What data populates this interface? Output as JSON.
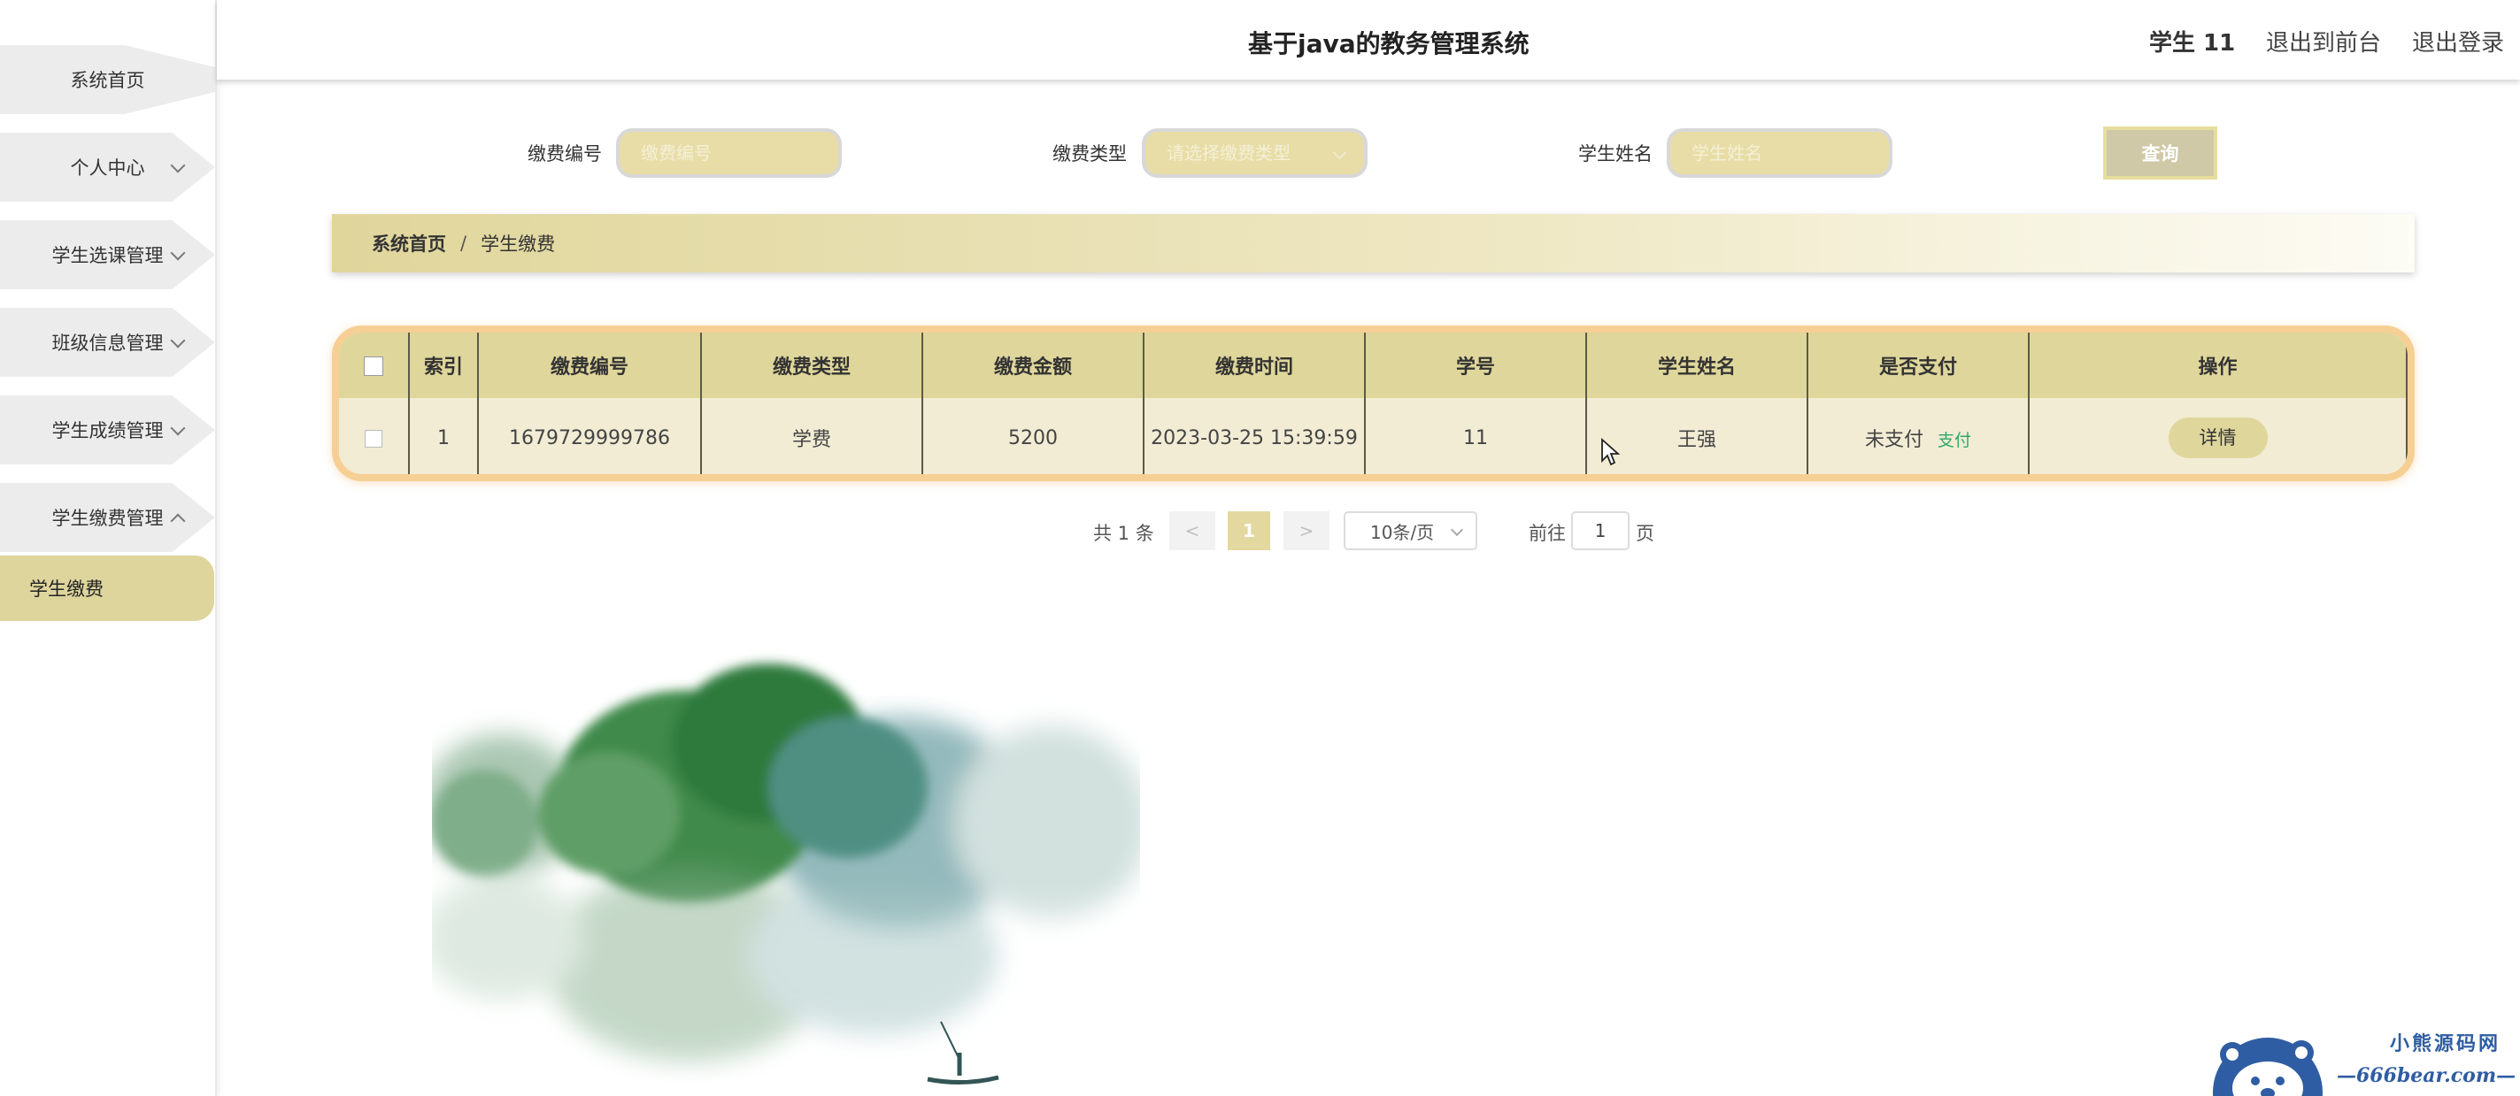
{
  "header": {
    "title": "基于java的教务管理系统",
    "user": "学生 11",
    "back_to_front": "退出到前台",
    "logout": "退出登录"
  },
  "sidebar": {
    "items": [
      {
        "label": "系统首页",
        "expandable": false
      },
      {
        "label": "个人中心",
        "expandable": true
      },
      {
        "label": "学生选课管理",
        "expandable": true
      },
      {
        "label": "班级信息管理",
        "expandable": true
      },
      {
        "label": "学生成绩管理",
        "expandable": true
      },
      {
        "label": "学生缴费管理",
        "expandable": true,
        "expanded": true
      }
    ],
    "active_submenu": "学生缴费"
  },
  "search": {
    "fee_no_label": "缴费编号",
    "fee_no_placeholder": "缴费编号",
    "fee_type_label": "缴费类型",
    "fee_type_placeholder": "请选择缴费类型",
    "student_name_label": "学生姓名",
    "student_name_placeholder": "学生姓名",
    "query_button": "查询"
  },
  "breadcrumb": {
    "home": "系统首页",
    "separator": "/",
    "current": "学生缴费"
  },
  "table": {
    "columns": [
      "索引",
      "缴费编号",
      "缴费类型",
      "缴费金额",
      "缴费时间",
      "学号",
      "学生姓名",
      "是否支付",
      "操作"
    ],
    "rows": [
      {
        "index": "1",
        "fee_no": "1679729999786",
        "fee_type": "学费",
        "amount": "5200",
        "time": "2023-03-25 15:39:59",
        "student_no": "11",
        "student_name": "王强",
        "paid_status": "未支付",
        "pay_link": "支付",
        "detail_button": "详情"
      }
    ]
  },
  "pagination": {
    "total": "共 1 条",
    "prev": "<",
    "current_page": "1",
    "next": ">",
    "page_size": "10条/页",
    "goto_label": "前往",
    "goto_value": "1",
    "goto_suffix": "页"
  },
  "watermark": {
    "line1": "小熊源码网",
    "line2": "—666bear.com—"
  },
  "colors": {
    "accent": "#dfd69b",
    "table_border": "#f6cf94",
    "pay_link": "#2ea86a",
    "watermark": "#2f5da3"
  }
}
